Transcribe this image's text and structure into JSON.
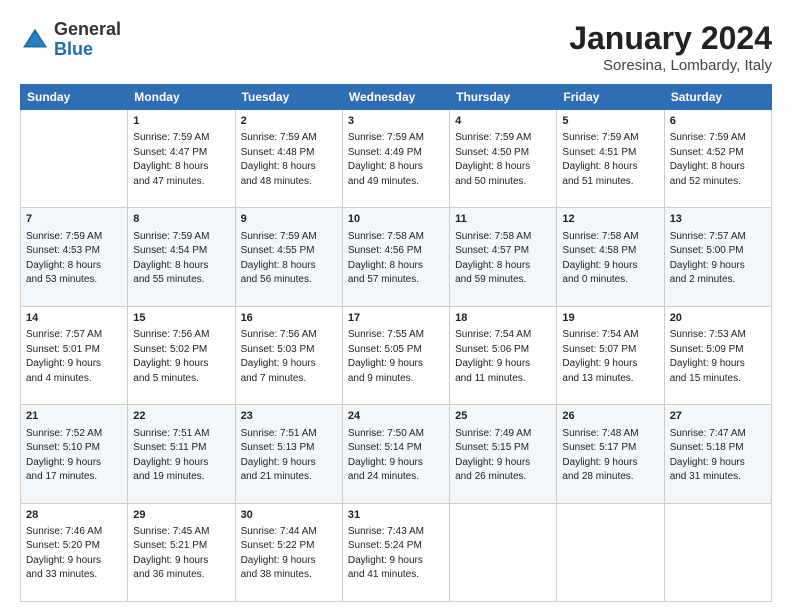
{
  "header": {
    "logo_general": "General",
    "logo_blue": "Blue",
    "main_title": "January 2024",
    "subtitle": "Soresina, Lombardy, Italy"
  },
  "columns": [
    "Sunday",
    "Monday",
    "Tuesday",
    "Wednesday",
    "Thursday",
    "Friday",
    "Saturday"
  ],
  "weeks": [
    [
      {
        "day": "",
        "info": ""
      },
      {
        "day": "1",
        "info": "Sunrise: 7:59 AM\nSunset: 4:47 PM\nDaylight: 8 hours\nand 47 minutes."
      },
      {
        "day": "2",
        "info": "Sunrise: 7:59 AM\nSunset: 4:48 PM\nDaylight: 8 hours\nand 48 minutes."
      },
      {
        "day": "3",
        "info": "Sunrise: 7:59 AM\nSunset: 4:49 PM\nDaylight: 8 hours\nand 49 minutes."
      },
      {
        "day": "4",
        "info": "Sunrise: 7:59 AM\nSunset: 4:50 PM\nDaylight: 8 hours\nand 50 minutes."
      },
      {
        "day": "5",
        "info": "Sunrise: 7:59 AM\nSunset: 4:51 PM\nDaylight: 8 hours\nand 51 minutes."
      },
      {
        "day": "6",
        "info": "Sunrise: 7:59 AM\nSunset: 4:52 PM\nDaylight: 8 hours\nand 52 minutes."
      }
    ],
    [
      {
        "day": "7",
        "info": "Sunrise: 7:59 AM\nSunset: 4:53 PM\nDaylight: 8 hours\nand 53 minutes."
      },
      {
        "day": "8",
        "info": "Sunrise: 7:59 AM\nSunset: 4:54 PM\nDaylight: 8 hours\nand 55 minutes."
      },
      {
        "day": "9",
        "info": "Sunrise: 7:59 AM\nSunset: 4:55 PM\nDaylight: 8 hours\nand 56 minutes."
      },
      {
        "day": "10",
        "info": "Sunrise: 7:58 AM\nSunset: 4:56 PM\nDaylight: 8 hours\nand 57 minutes."
      },
      {
        "day": "11",
        "info": "Sunrise: 7:58 AM\nSunset: 4:57 PM\nDaylight: 8 hours\nand 59 minutes."
      },
      {
        "day": "12",
        "info": "Sunrise: 7:58 AM\nSunset: 4:58 PM\nDaylight: 9 hours\nand 0 minutes."
      },
      {
        "day": "13",
        "info": "Sunrise: 7:57 AM\nSunset: 5:00 PM\nDaylight: 9 hours\nand 2 minutes."
      }
    ],
    [
      {
        "day": "14",
        "info": "Sunrise: 7:57 AM\nSunset: 5:01 PM\nDaylight: 9 hours\nand 4 minutes."
      },
      {
        "day": "15",
        "info": "Sunrise: 7:56 AM\nSunset: 5:02 PM\nDaylight: 9 hours\nand 5 minutes."
      },
      {
        "day": "16",
        "info": "Sunrise: 7:56 AM\nSunset: 5:03 PM\nDaylight: 9 hours\nand 7 minutes."
      },
      {
        "day": "17",
        "info": "Sunrise: 7:55 AM\nSunset: 5:05 PM\nDaylight: 9 hours\nand 9 minutes."
      },
      {
        "day": "18",
        "info": "Sunrise: 7:54 AM\nSunset: 5:06 PM\nDaylight: 9 hours\nand 11 minutes."
      },
      {
        "day": "19",
        "info": "Sunrise: 7:54 AM\nSunset: 5:07 PM\nDaylight: 9 hours\nand 13 minutes."
      },
      {
        "day": "20",
        "info": "Sunrise: 7:53 AM\nSunset: 5:09 PM\nDaylight: 9 hours\nand 15 minutes."
      }
    ],
    [
      {
        "day": "21",
        "info": "Sunrise: 7:52 AM\nSunset: 5:10 PM\nDaylight: 9 hours\nand 17 minutes."
      },
      {
        "day": "22",
        "info": "Sunrise: 7:51 AM\nSunset: 5:11 PM\nDaylight: 9 hours\nand 19 minutes."
      },
      {
        "day": "23",
        "info": "Sunrise: 7:51 AM\nSunset: 5:13 PM\nDaylight: 9 hours\nand 21 minutes."
      },
      {
        "day": "24",
        "info": "Sunrise: 7:50 AM\nSunset: 5:14 PM\nDaylight: 9 hours\nand 24 minutes."
      },
      {
        "day": "25",
        "info": "Sunrise: 7:49 AM\nSunset: 5:15 PM\nDaylight: 9 hours\nand 26 minutes."
      },
      {
        "day": "26",
        "info": "Sunrise: 7:48 AM\nSunset: 5:17 PM\nDaylight: 9 hours\nand 28 minutes."
      },
      {
        "day": "27",
        "info": "Sunrise: 7:47 AM\nSunset: 5:18 PM\nDaylight: 9 hours\nand 31 minutes."
      }
    ],
    [
      {
        "day": "28",
        "info": "Sunrise: 7:46 AM\nSunset: 5:20 PM\nDaylight: 9 hours\nand 33 minutes."
      },
      {
        "day": "29",
        "info": "Sunrise: 7:45 AM\nSunset: 5:21 PM\nDaylight: 9 hours\nand 36 minutes."
      },
      {
        "day": "30",
        "info": "Sunrise: 7:44 AM\nSunset: 5:22 PM\nDaylight: 9 hours\nand 38 minutes."
      },
      {
        "day": "31",
        "info": "Sunrise: 7:43 AM\nSunset: 5:24 PM\nDaylight: 9 hours\nand 41 minutes."
      },
      {
        "day": "",
        "info": ""
      },
      {
        "day": "",
        "info": ""
      },
      {
        "day": "",
        "info": ""
      }
    ]
  ]
}
